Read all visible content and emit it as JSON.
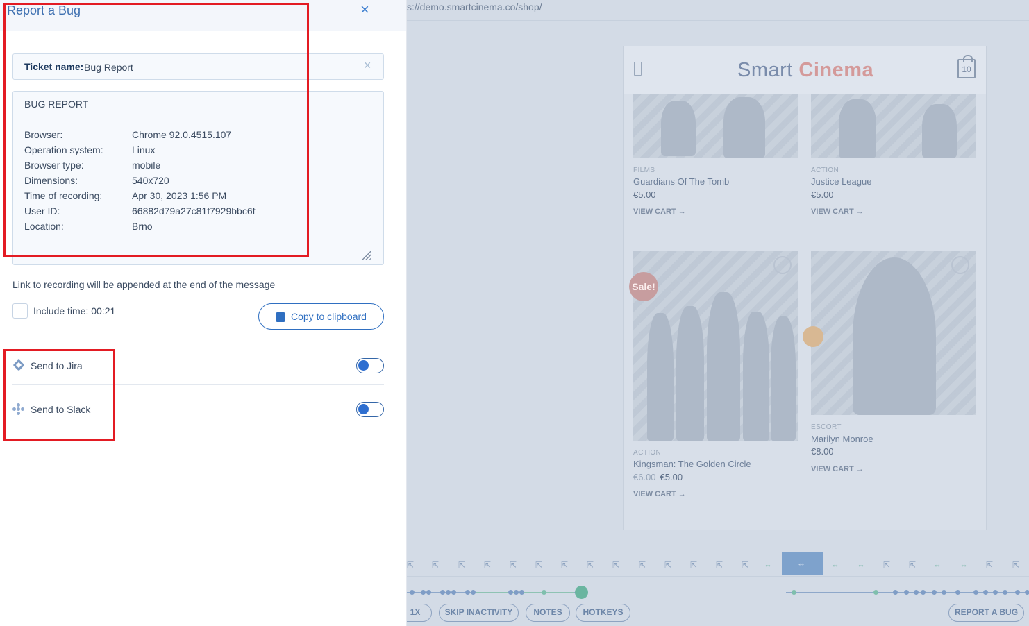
{
  "panel": {
    "title": "Report a Bug",
    "close_icon": "close-icon",
    "ticket": {
      "label": "Ticket name:",
      "value": "Bug Report"
    },
    "report": {
      "heading": "BUG REPORT",
      "rows": [
        {
          "key": "Browser:",
          "value": "Chrome 92.0.4515.107"
        },
        {
          "key": "Operation system:",
          "value": "Linux"
        },
        {
          "key": "Browser type:",
          "value": "mobile"
        },
        {
          "key": "Dimensions:",
          "value": "540x720"
        },
        {
          "key": "Time of recording:",
          "value": "Apr 30, 2023 1:56 PM"
        },
        {
          "key": "User ID:",
          "value": "66882d79a27c81f7929bbc6f"
        },
        {
          "key": "Location:",
          "value": "Brno"
        }
      ]
    },
    "link_note": "Link to recording will be appended at the end of the message",
    "include_time": {
      "label": "Include time: 00:21",
      "checked": false
    },
    "copy_button": "Copy to clipboard",
    "integrations": [
      {
        "label": "Send to Jira",
        "enabled": true
      },
      {
        "label": "Send to Slack",
        "enabled": true
      }
    ],
    "annotation_color": "#e31b23"
  },
  "replay": {
    "url": "s://demo.smartcinema.co/shop/",
    "site": {
      "logo_text_1": "Smart",
      "logo_text_2": "Cinema",
      "cart_count": "10",
      "products": [
        {
          "category": "FILMS",
          "name": "Guardians Of The Tomb",
          "price": "€5.00",
          "action": "VIEW CART →"
        },
        {
          "category": "ACTION",
          "name": "Justice League",
          "price": "€5.00",
          "action": "VIEW CART →"
        },
        {
          "category": "ACTION",
          "name": "Kingsman: The Golden Circle",
          "old_price": "€6.00",
          "price": "€5.00",
          "action": "VIEW CART →",
          "badge": "Sale!"
        },
        {
          "category": "ESCORT",
          "name": "Marilyn Monroe",
          "price": "€8.00",
          "action": "VIEW CART →"
        }
      ]
    },
    "controls": {
      "speed": "1X",
      "skip": "SKIP INACTIVITY",
      "notes": "NOTES",
      "hotkeys": "HOTKEYS",
      "report": "REPORT A BUG"
    },
    "colors": {
      "accent": "#2f6fc1",
      "overlay": "#d3dbe6"
    }
  }
}
